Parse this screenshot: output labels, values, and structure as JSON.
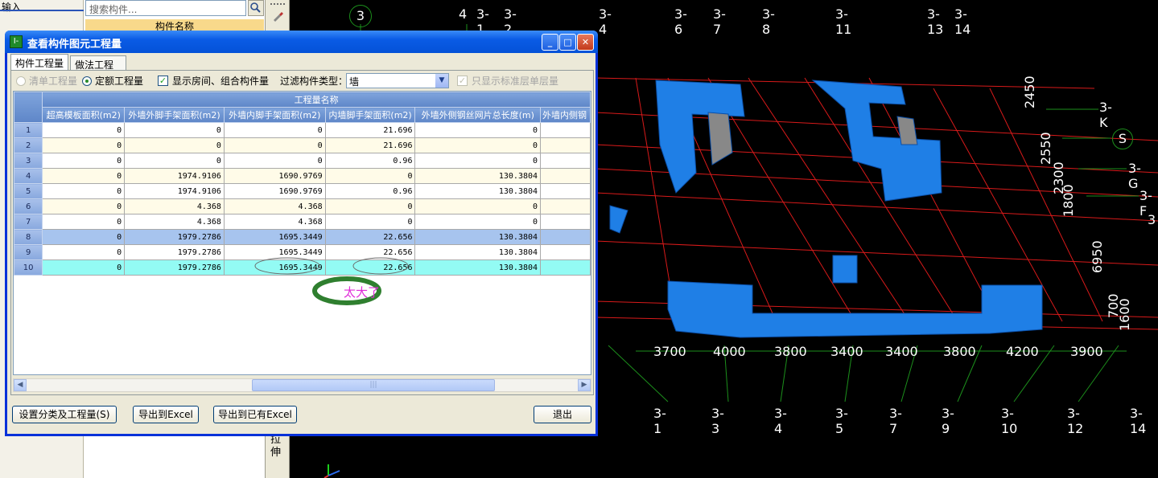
{
  "background": {
    "left_label": "输入",
    "search_placeholder": "搜索构件...",
    "panel_header": "构件名称",
    "tool_pull_label": "拉伸",
    "axes_top": [
      "3",
      "4",
      "3-1",
      "3-2",
      "3-4",
      "3-6",
      "3-7",
      "3-8",
      "3-11",
      "3-13",
      "3-14"
    ],
    "axes_right": [
      "3-K",
      "S",
      "3-G",
      "3-F",
      "3"
    ],
    "axes_bottom": [
      "3-1",
      "3-3",
      "3-4",
      "3-5",
      "3-7",
      "3-9",
      "3-10",
      "3-12",
      "3-14"
    ],
    "dims_bottom": [
      "3700",
      "4000",
      "3800",
      "3400",
      "3400",
      "3800",
      "4200",
      "3900"
    ],
    "dims_right": [
      "2450",
      "2550",
      "2300",
      "1800",
      "6950",
      "700",
      "1600"
    ]
  },
  "dialog": {
    "title": "查看构件图元工程量",
    "tabs": [
      "构件工程量",
      "做法工程量"
    ],
    "options": {
      "list_qty": "清单工程量",
      "quota_qty": "定额工程量",
      "show_room": "显示房间、组合构件量",
      "filter_label": "过滤构件类型：",
      "filter_value": "墙",
      "std_floor_only": "只显示标准层单层量"
    },
    "group_header": "工程量名称",
    "columns": [
      "超高模板面积(m2)",
      "外墙外脚手架面积(m2)",
      "外墙内脚手架面积(m2)",
      "内墙脚手架面积(m2)",
      "外墙外侧钢丝网片总长度(m)",
      "外墙内侧钢"
    ],
    "rows": [
      {
        "n": "1",
        "c": [
          "0",
          "0",
          "0",
          "21.696",
          "0",
          ""
        ]
      },
      {
        "n": "2",
        "c": [
          "0",
          "0",
          "0",
          "21.696",
          "0",
          ""
        ]
      },
      {
        "n": "3",
        "c": [
          "0",
          "0",
          "0",
          "0.96",
          "0",
          ""
        ]
      },
      {
        "n": "4",
        "c": [
          "0",
          "1974.9106",
          "1690.9769",
          "0",
          "130.3804",
          ""
        ]
      },
      {
        "n": "5",
        "c": [
          "0",
          "1974.9106",
          "1690.9769",
          "0.96",
          "130.3804",
          ""
        ]
      },
      {
        "n": "6",
        "c": [
          "0",
          "4.368",
          "4.368",
          "0",
          "0",
          ""
        ]
      },
      {
        "n": "7",
        "c": [
          "0",
          "4.368",
          "4.368",
          "0",
          "0",
          ""
        ]
      },
      {
        "n": "8",
        "c": [
          "0",
          "1979.2786",
          "1695.3449",
          "22.656",
          "130.3804",
          ""
        ]
      },
      {
        "n": "9",
        "c": [
          "0",
          "1979.2786",
          "1695.3449",
          "22.656",
          "130.3804",
          ""
        ]
      },
      {
        "n": "10",
        "c": [
          "0",
          "1979.2786",
          "1695.3449",
          "22.656",
          "130.3804",
          ""
        ]
      }
    ],
    "annotation": "太大了",
    "buttons": {
      "setup": "设置分类及工程量(S)",
      "export_excel": "导出到Excel",
      "export_existing": "导出到已有Excel",
      "exit": "退出"
    }
  }
}
